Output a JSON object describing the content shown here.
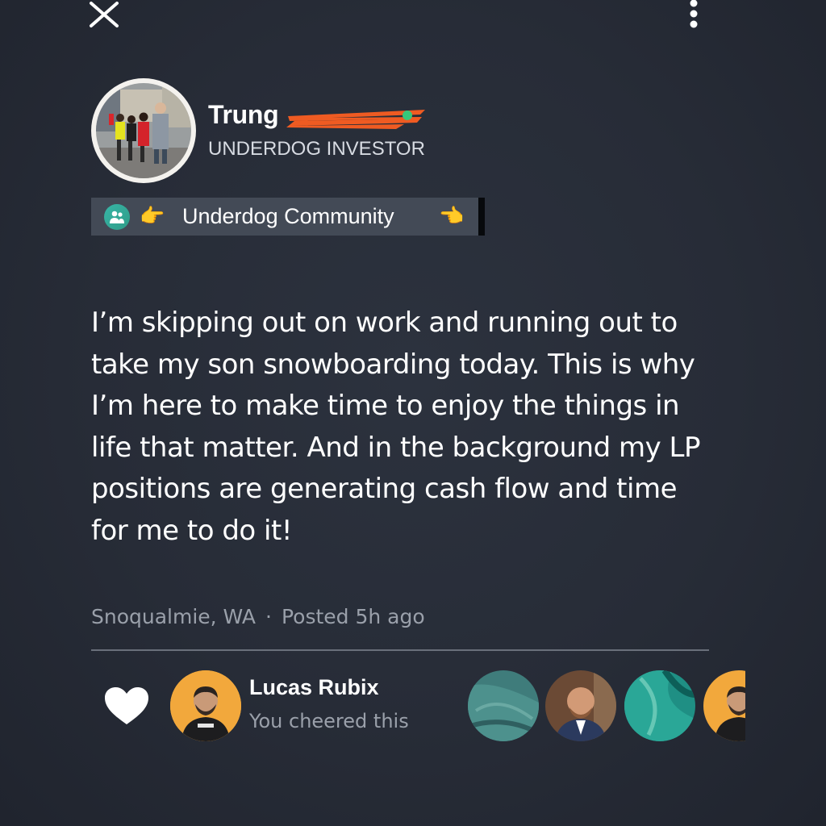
{
  "header": {
    "close_icon": "close-icon",
    "more_icon": "more-vertical-icon"
  },
  "author": {
    "name": "Trung",
    "role": "UNDERDOG INVESTOR",
    "status_color": "#36c77a"
  },
  "community": {
    "icon": "people-group-icon",
    "emoji_left": "👉",
    "label": "Underdog Community",
    "emoji_right": "👈"
  },
  "post": {
    "body": "I’m skipping out on work and running out to take my son snowboarding today. This is why I’m here to make time to enjoy the things in life that matter. And in the background my LP positions are generating cash flow and time for me to do it!",
    "location": "Snoqualmie, WA",
    "separator": "·",
    "posted": "Posted 5h ago"
  },
  "cheers": {
    "heart_icon": "heart-icon",
    "name": "Lucas Rubix",
    "status": "You cheered this"
  },
  "colors": {
    "background": "#272c37",
    "chip_background": "#434a56",
    "muted_text": "#9aa0aa",
    "avatar_accent": "#f2a83c"
  }
}
